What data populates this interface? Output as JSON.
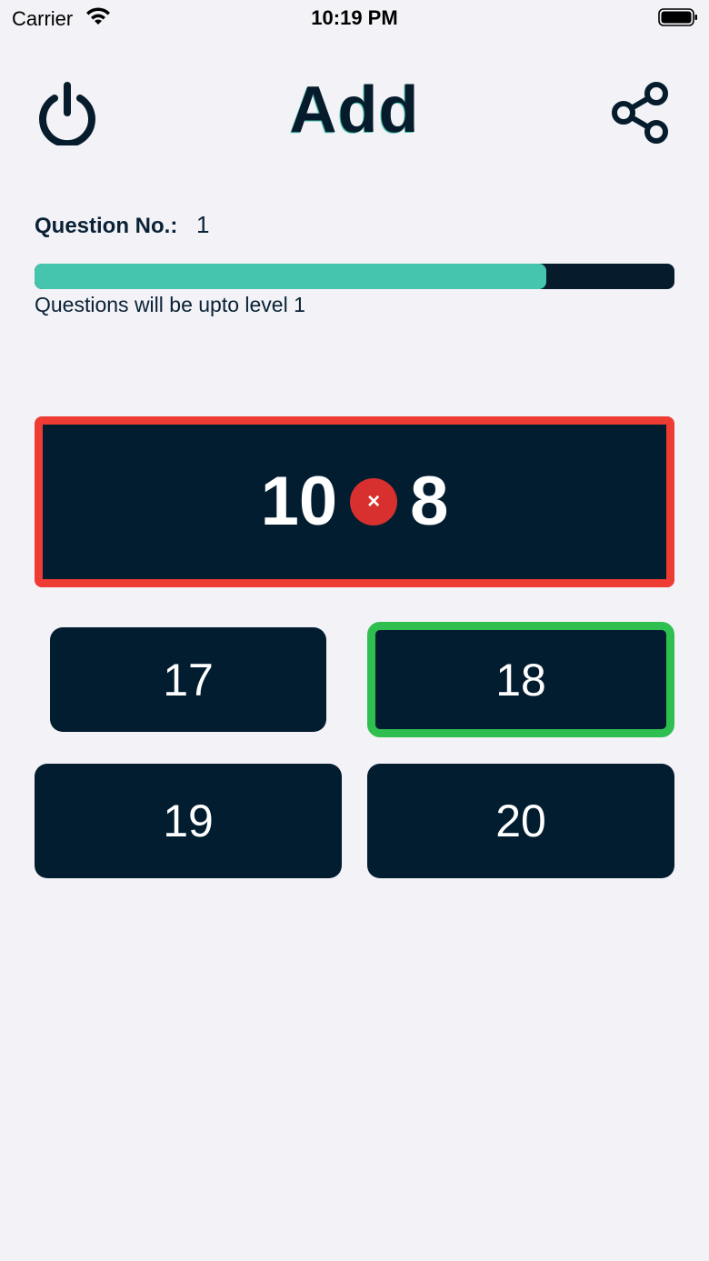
{
  "status_bar": {
    "carrier": "Carrier",
    "time": "10:19 PM",
    "icons": [
      "wifi-icon",
      "battery-icon"
    ]
  },
  "header": {
    "title": "Add",
    "power_icon": "power-icon",
    "share_icon": "share-icon"
  },
  "question": {
    "label": "Question No.:",
    "number": "1",
    "progress_fraction": 0.8,
    "level_text": "Questions will be upto level 1"
  },
  "problem": {
    "left_operand": "10",
    "operator_symbol": "×",
    "right_operand": "8",
    "operator_icon": "incorrect-x-icon"
  },
  "answers": [
    "17",
    "18",
    "19",
    "20"
  ],
  "colors": {
    "background": "#f2f2f7",
    "navy": "#031d30",
    "teal": "#45c4ae",
    "wrong_border": "#ee3b33",
    "correct_border": "#2fbf50",
    "wrong_badge": "#d8302f"
  }
}
